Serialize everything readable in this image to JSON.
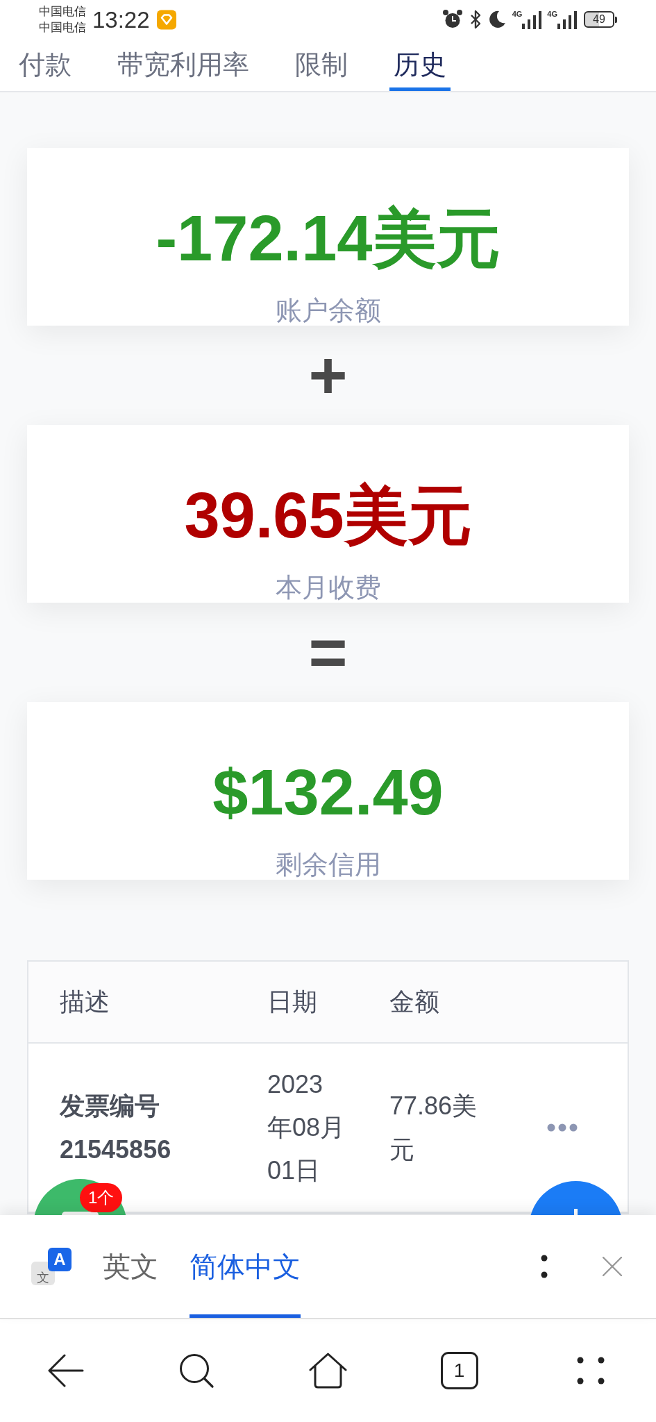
{
  "status_bar": {
    "carriers": [
      "中国电信",
      "中国电信"
    ],
    "time": "13:22",
    "network_types": [
      "4G",
      "4G"
    ],
    "battery": "49"
  },
  "tabs": [
    {
      "label": "付款",
      "selected": false
    },
    {
      "label": "带宽利用率",
      "selected": false
    },
    {
      "label": "限制",
      "selected": false
    },
    {
      "label": "历史",
      "selected": true
    }
  ],
  "summary": {
    "cards": [
      {
        "amount": "-172.14美元",
        "label": "账户余额",
        "color": "#2a9a2a"
      },
      {
        "amount": "39.65美元",
        "label": "本月收费",
        "color": "#b00000"
      },
      {
        "amount": "$132.49",
        "label": "剩余信用",
        "color": "#2a9a2a"
      }
    ],
    "operators": [
      "+",
      "="
    ]
  },
  "table": {
    "columns": [
      "描述",
      "日期",
      "金额"
    ],
    "rows": [
      {
        "description": "发票编号 21545856",
        "date": "2023年08月01日",
        "amount": "77.86美元"
      }
    ]
  },
  "chat_badge": "1个",
  "translate_bar": {
    "icon_glyphs": [
      "文",
      "A"
    ],
    "languages": [
      {
        "label": "英文",
        "selected": false
      },
      {
        "label": "简体中文",
        "selected": true
      }
    ]
  },
  "nav_bar": {
    "tab_count": "1"
  }
}
